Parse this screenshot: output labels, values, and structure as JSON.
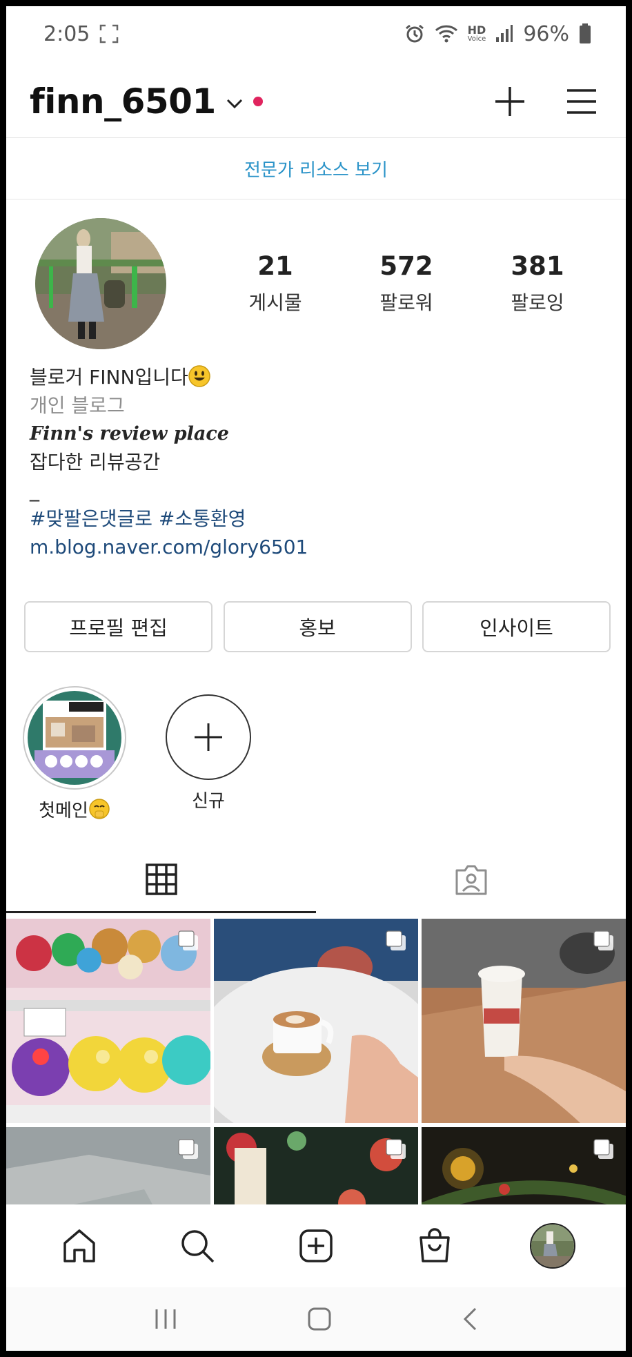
{
  "status_bar": {
    "time": "2:05",
    "hd_label": "HD",
    "voice_label": "Voice",
    "battery": "96%"
  },
  "header": {
    "username": "finn_6501",
    "dot_color": "#e0245e"
  },
  "pro_link": "전문가 리소스 보기",
  "stats": [
    {
      "value": "21",
      "label": "게시물"
    },
    {
      "value": "572",
      "label": "팔로워"
    },
    {
      "value": "381",
      "label": "팔로잉"
    }
  ],
  "bio": {
    "line1": "블로거 FINN입니다",
    "category": "개인 블로그",
    "script_line": "Finn's review place",
    "line3": "잡다한 리뷰공간",
    "dash": "_",
    "hashtags": "#맞팔은댓글로 #소통환영",
    "link": "m.blog.naver.com/glory6501"
  },
  "buttons": {
    "edit_profile": "프로필 편집",
    "promote": "홍보",
    "insights": "인사이트"
  },
  "highlights": [
    {
      "label": "첫메인"
    },
    {
      "label": "신규"
    }
  ],
  "accent_colors": {
    "link_blue": "#2a93c8",
    "bio_link": "#1e4a7a"
  }
}
